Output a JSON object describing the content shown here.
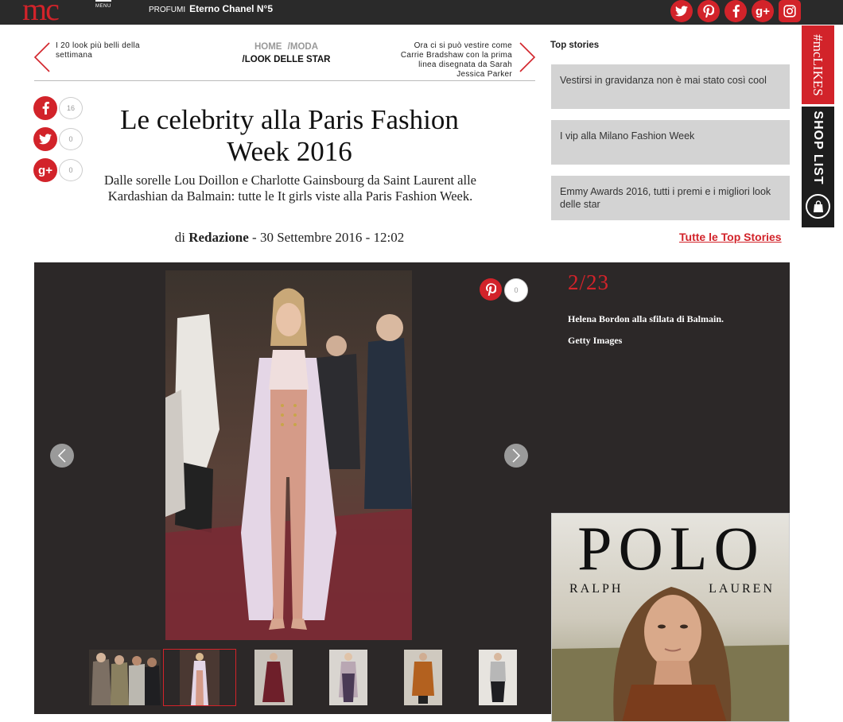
{
  "header": {
    "logo": "mc",
    "menu_label": "MENU",
    "promo_category": "PROFUMI",
    "promo_title": "Eterno Chanel N°5",
    "social": [
      {
        "icon": "twitter-icon",
        "glyph": "t"
      },
      {
        "icon": "pinterest-icon",
        "glyph": "p"
      },
      {
        "icon": "facebook-icon",
        "glyph": "f"
      },
      {
        "icon": "google-plus-icon",
        "glyph": "g+"
      },
      {
        "icon": "instagram-icon",
        "glyph": "◎"
      }
    ]
  },
  "article_nav": {
    "prev_title": "I 20 look più belli della settimana",
    "next_title": "Ora ci si può vestire come Carrie Bradshaw con la prima linea disegnata da Sarah Jessica Parker",
    "breadcrumb": {
      "home": "HOME",
      "sep1": "/",
      "section": "MODA",
      "sep2": "/",
      "subsection": "LOOK DELLE STAR"
    }
  },
  "share": {
    "facebook_count": "16",
    "twitter_count": "0",
    "googleplus_count": "0"
  },
  "article": {
    "title": "Le celebrity alla Paris Fashion Week 2016",
    "subtitle": "Dalle sorelle Lou Doillon e Charlotte Gainsbourg da Saint Laurent alle Kardashian da Balmain: tutte le It girls viste alla Paris Fashion Week.",
    "byline_prefix": "di",
    "author": "Redazione",
    "date": "- 30 Settembre 2016 - 12:02"
  },
  "top_stories": {
    "heading": "Top stories",
    "items": [
      "Vestirsi in gravidanza non è mai stato così cool",
      "I vip alla Milano Fashion Week",
      "Emmy Awards 2016, tutti i premi e i migliori look delle star"
    ],
    "all_link": "Tutte le Top Stories"
  },
  "side_tabs": {
    "mclikes": "#mcLIKES",
    "shoplist": "SHOP LIST"
  },
  "gallery": {
    "counter": "2/23",
    "caption_line1": "Helena Bordon alla sfilata di Balmain.",
    "caption_line2": "Getty Images",
    "pin_count": "0",
    "selected_thumb": 2
  },
  "ad": {
    "brand": "POLO",
    "sub_left": "RALPH",
    "sub_right": "LAUREN"
  },
  "colors": {
    "accent": "#d2232a",
    "topbar": "#2a2a2a",
    "gallery_bg": "#2c2828",
    "story_box": "#d3d3d3"
  }
}
